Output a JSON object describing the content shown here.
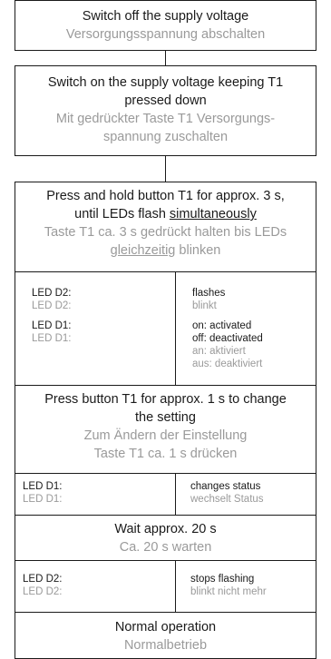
{
  "steps": {
    "s1": {
      "en": "Switch off the supply voltage",
      "de": "Versorgungsspannung abschalten"
    },
    "s2": {
      "en1": "Switch on the supply voltage keeping T1",
      "en2": "pressed down",
      "de1": "Mit gedrückter Taste T1 Versorgungs-",
      "de2": "spannung zuschalten"
    },
    "s3": {
      "en1": "Press and hold button T1 for approx. 3 s,",
      "en2a": "until LEDs flash ",
      "en2u": "simultaneously",
      "de1": "Taste T1 ca. 3 s gedrückt halten bis LEDs",
      "de2u": "gleichzeitig",
      "de2b": " blinken"
    },
    "s4": {
      "en1": "Press button T1 for approx. 1 s to change",
      "en2": "the setting",
      "de1": "Zum Ändern der Einstellung",
      "de2": "Taste T1 ca. 1 s drücken"
    },
    "s5": {
      "en": "Wait approx. 20 s",
      "de": "Ca. 20 s warten"
    },
    "s6": {
      "en": "Normal operation",
      "de": "Normalbetrieb"
    }
  },
  "table1": {
    "row1": {
      "left_en": "LED D2:",
      "left_de": "LED D2:",
      "right_en": "flashes",
      "right_de": "blinkt"
    },
    "row2": {
      "left_en": "LED D1:",
      "left_de": "LED D1:",
      "right_en1": "on: activated",
      "right_en2": "off: deactivated",
      "right_de1": "an: aktiviert",
      "right_de2": "aus: deaktiviert"
    }
  },
  "table2": {
    "left_en": "LED D1:",
    "left_de": "LED D1:",
    "right_en": "changes status",
    "right_de": "wechselt Status"
  },
  "table3": {
    "left_en": "LED D2:",
    "left_de": "LED D2:",
    "right_en": "stops flashing",
    "right_de": "blinkt nicht mehr"
  }
}
